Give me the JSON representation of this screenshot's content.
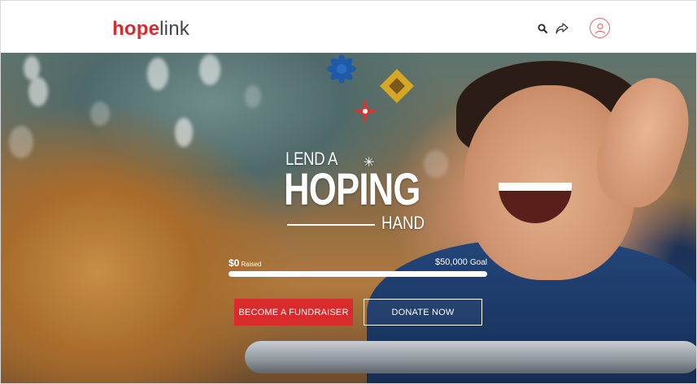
{
  "brand": {
    "part1": "hope",
    "part2": "link",
    "accent": "#d92b2b"
  },
  "header": {
    "icons": [
      "search-icon",
      "share-icon",
      "user-avatar-icon"
    ]
  },
  "hero": {
    "line1": "LEND A",
    "line2": "HOPING",
    "line3": "HAND",
    "flake": "✳"
  },
  "fundraising": {
    "raised_amount": "$0",
    "raised_label": "Raised",
    "goal_amount": "$50,000",
    "goal_label": "Goal",
    "progress_fraction": 0
  },
  "buttons": {
    "fundraiser": "BECOME A FUNDRAISER",
    "donate": "DONATE NOW"
  }
}
